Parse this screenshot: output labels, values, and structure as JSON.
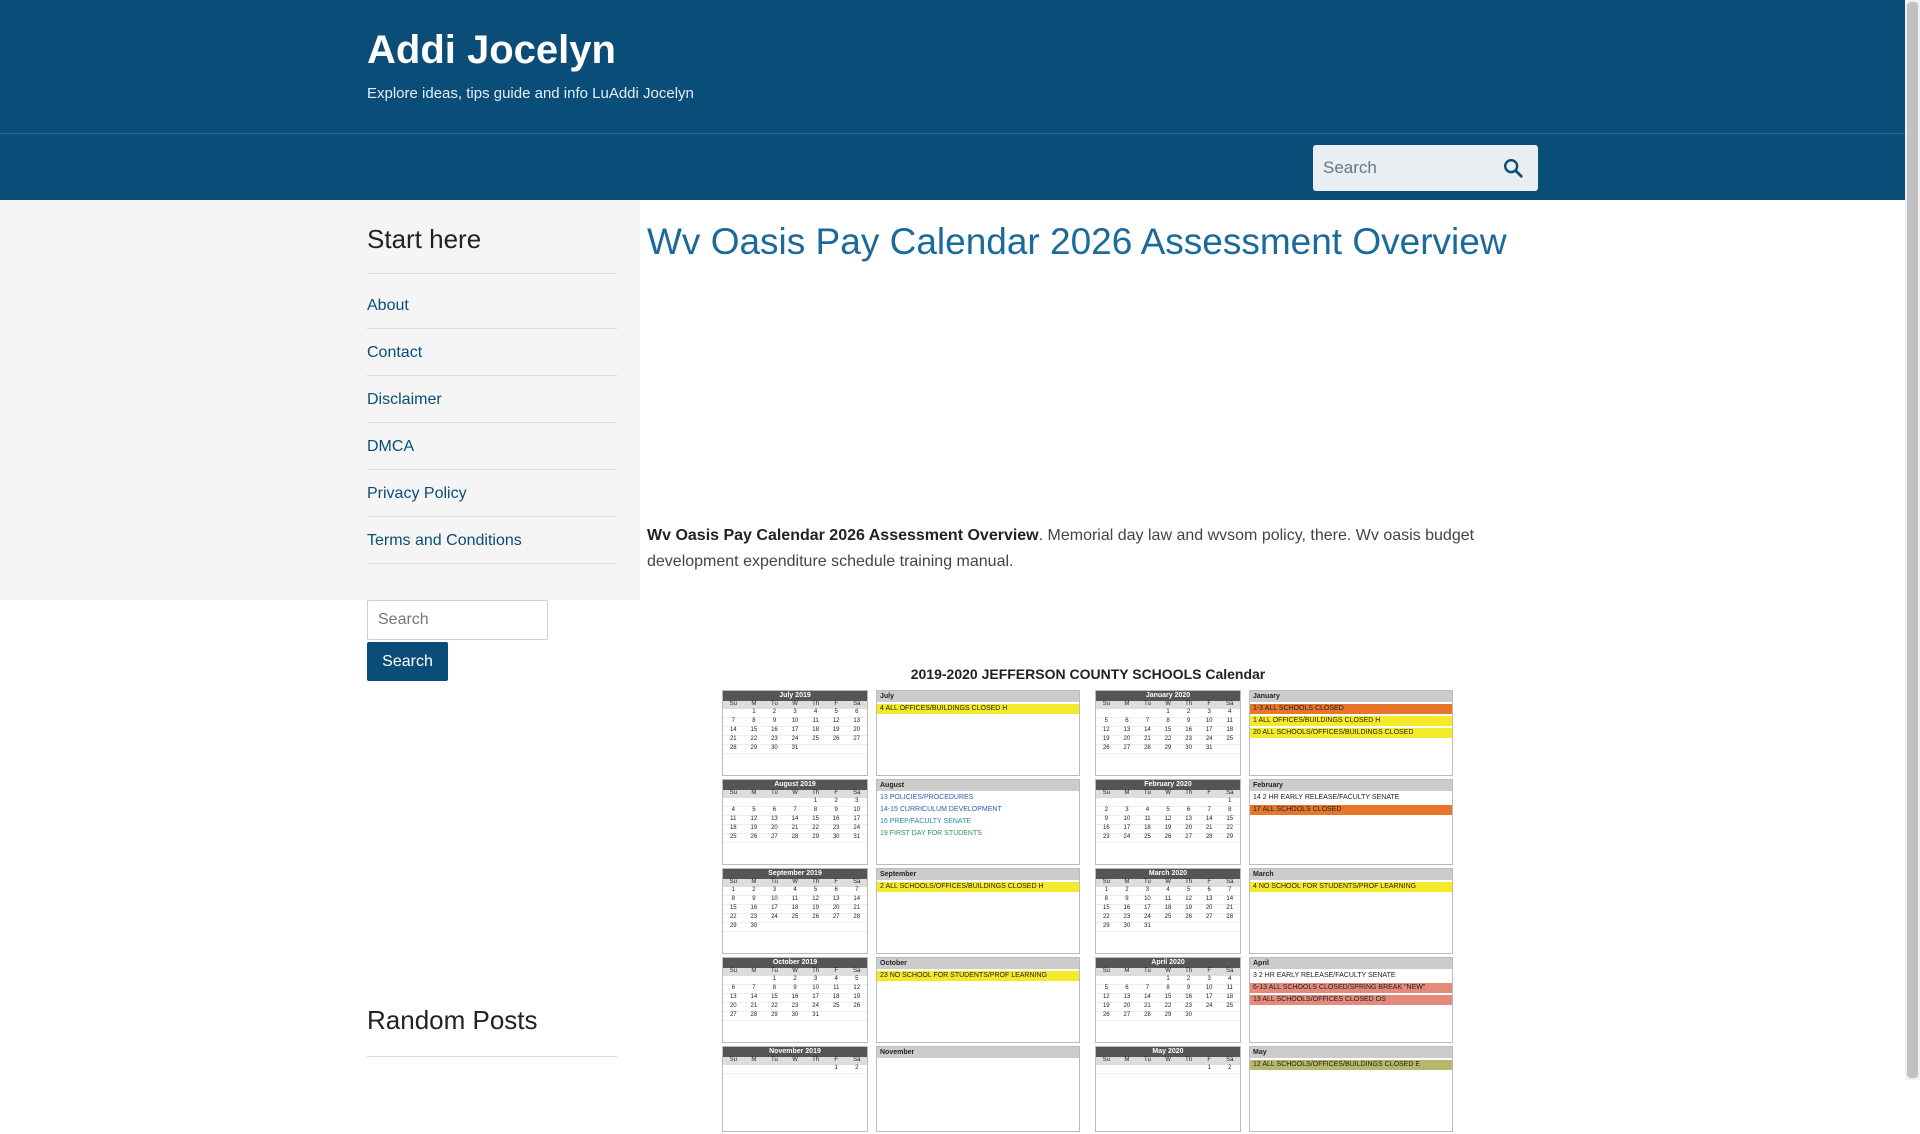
{
  "site": {
    "title": "Addi Jocelyn",
    "description": "Explore ideas, tips guide and info LuAddi Jocelyn"
  },
  "nav_search": {
    "placeholder": "Search"
  },
  "sidebar": {
    "heading": "Start here",
    "links": [
      "About",
      "Contact",
      "Disclaimer",
      "DMCA",
      "Privacy Policy",
      "Terms and Conditions"
    ],
    "search_placeholder": "Search",
    "search_button": "Search",
    "random_heading": "Random Posts"
  },
  "post": {
    "title": "Wv Oasis Pay Calendar 2026 Assessment Overview",
    "excerpt_bold": "Wv Oasis Pay Calendar 2026 Assessment Overview",
    "excerpt_rest": ". Memorial day law and wvsom policy, there. Wv oasis budget development expenditure schedule training manual."
  },
  "calendar_image": {
    "title": "2019-2020 JEFFERSON COUNTY SCHOOLS Calendar",
    "dow": [
      "Su",
      "M",
      "Tu",
      "W",
      "Th",
      "F",
      "Sa"
    ],
    "rows": [
      {
        "left_month": "July 2019",
        "left_weeks": [
          [
            "",
            "1",
            "2",
            "3",
            "4",
            "5",
            "6"
          ],
          [
            "7",
            "8",
            "9",
            "10",
            "11",
            "12",
            "13"
          ],
          [
            "14",
            "15",
            "16",
            "17",
            "18",
            "19",
            "20"
          ],
          [
            "21",
            "22",
            "23",
            "24",
            "25",
            "26",
            "27"
          ],
          [
            "28",
            "29",
            "30",
            "31",
            "",
            "",
            ""
          ]
        ],
        "left_notes_head": "July",
        "left_notes": [
          {
            "t": "4     ALL OFFICES/BUILDINGS CLOSED H",
            "c": "hl-yellow"
          }
        ],
        "right_month": "January 2020",
        "right_weeks": [
          [
            "",
            "",
            "",
            "1",
            "2",
            "3",
            "4"
          ],
          [
            "5",
            "6",
            "7",
            "8",
            "9",
            "10",
            "11"
          ],
          [
            "12",
            "13",
            "14",
            "15",
            "16",
            "17",
            "18"
          ],
          [
            "19",
            "20",
            "21",
            "22",
            "23",
            "24",
            "25"
          ],
          [
            "26",
            "27",
            "28",
            "29",
            "30",
            "31",
            ""
          ]
        ],
        "right_notes_head": "January",
        "right_notes": [
          {
            "t": "1-3   ALL SCHOOLS CLOSED",
            "c": "hl-orange"
          },
          {
            "t": "1     ALL OFFICES/BUILDINGS CLOSED H",
            "c": "hl-yellow"
          },
          {
            "t": "20    ALL SCHOOLS/OFFICES/BUILDINGS CLOSED",
            "c": "hl-yellow"
          }
        ]
      },
      {
        "left_month": "August 2019",
        "left_weeks": [
          [
            "",
            "",
            "",
            "",
            "1",
            "2",
            "3"
          ],
          [
            "4",
            "5",
            "6",
            "7",
            "8",
            "9",
            "10"
          ],
          [
            "11",
            "12",
            "13",
            "14",
            "15",
            "16",
            "17"
          ],
          [
            "18",
            "19",
            "20",
            "21",
            "22",
            "23",
            "24"
          ],
          [
            "25",
            "26",
            "27",
            "28",
            "29",
            "30",
            "31"
          ]
        ],
        "left_notes_head": "August",
        "left_notes": [
          {
            "t": "13    POLICIES/PROCEDURES",
            "c": "txt-blue"
          },
          {
            "t": "14-15 CURRICULUM DEVELOPMENT",
            "c": "txt-blue"
          },
          {
            "t": "16    PREP/FACULTY SENATE",
            "c": "txt-teal"
          },
          {
            "t": "19    FIRST DAY FOR STUDENTS",
            "c": "txt-green"
          }
        ],
        "right_month": "February 2020",
        "right_weeks": [
          [
            "",
            "",
            "",
            "",
            "",
            "",
            "1"
          ],
          [
            "2",
            "3",
            "4",
            "5",
            "6",
            "7",
            "8"
          ],
          [
            "9",
            "10",
            "11",
            "12",
            "13",
            "14",
            "15"
          ],
          [
            "16",
            "17",
            "18",
            "19",
            "20",
            "21",
            "22"
          ],
          [
            "23",
            "24",
            "25",
            "26",
            "27",
            "28",
            "29"
          ]
        ],
        "right_notes_head": "February",
        "right_notes": [
          {
            "t": "14    2 HR EARLY RELEASE/FACULTY SENATE",
            "c": ""
          },
          {
            "t": "17    ALL SCHOOLS CLOSED",
            "c": "hl-orange"
          }
        ]
      },
      {
        "left_month": "September 2019",
        "left_weeks": [
          [
            "1",
            "2",
            "3",
            "4",
            "5",
            "6",
            "7"
          ],
          [
            "8",
            "9",
            "10",
            "11",
            "12",
            "13",
            "14"
          ],
          [
            "15",
            "16",
            "17",
            "18",
            "19",
            "20",
            "21"
          ],
          [
            "22",
            "23",
            "24",
            "25",
            "26",
            "27",
            "28"
          ],
          [
            "29",
            "30",
            "",
            "",
            "",
            "",
            ""
          ]
        ],
        "left_notes_head": "September",
        "left_notes": [
          {
            "t": "2     ALL SCHOOLS/OFFICES/BUILDINGS CLOSED H",
            "c": "hl-yellow"
          }
        ],
        "right_month": "March 2020",
        "right_weeks": [
          [
            "1",
            "2",
            "3",
            "4",
            "5",
            "6",
            "7"
          ],
          [
            "8",
            "9",
            "10",
            "11",
            "12",
            "13",
            "14"
          ],
          [
            "15",
            "16",
            "17",
            "18",
            "19",
            "20",
            "21"
          ],
          [
            "22",
            "23",
            "24",
            "25",
            "26",
            "27",
            "28"
          ],
          [
            "29",
            "30",
            "31",
            "",
            "",
            "",
            ""
          ]
        ],
        "right_notes_head": "March",
        "right_notes": [
          {
            "t": "4     NO SCHOOL FOR STUDENTS/PROF LEARNING",
            "c": "hl-yellow"
          }
        ]
      },
      {
        "left_month": "October 2019",
        "left_weeks": [
          [
            "",
            "",
            "1",
            "2",
            "3",
            "4",
            "5"
          ],
          [
            "6",
            "7",
            "8",
            "9",
            "10",
            "11",
            "12"
          ],
          [
            "13",
            "14",
            "15",
            "16",
            "17",
            "18",
            "19"
          ],
          [
            "20",
            "21",
            "22",
            "23",
            "24",
            "25",
            "26"
          ],
          [
            "27",
            "28",
            "29",
            "30",
            "31",
            "",
            ""
          ]
        ],
        "left_notes_head": "October",
        "left_notes": [
          {
            "t": "23    NO SCHOOL FOR STUDENTS/PROF LEARNING",
            "c": "hl-yellow"
          }
        ],
        "right_month": "April 2020",
        "right_weeks": [
          [
            "",
            "",
            "",
            "1",
            "2",
            "3",
            "4"
          ],
          [
            "5",
            "6",
            "7",
            "8",
            "9",
            "10",
            "11"
          ],
          [
            "12",
            "13",
            "14",
            "15",
            "16",
            "17",
            "18"
          ],
          [
            "19",
            "20",
            "21",
            "22",
            "23",
            "24",
            "25"
          ],
          [
            "26",
            "27",
            "28",
            "29",
            "30",
            "",
            ""
          ]
        ],
        "right_notes_head": "April",
        "right_notes": [
          {
            "t": "3     2 HR EARLY RELEASE/FACULTY SENATE",
            "c": ""
          },
          {
            "t": "6-13  ALL SCHOOLS CLOSED/SPRING BREAK \"NEW\"",
            "c": "hl-salmon"
          },
          {
            "t": "13    ALL SCHOOLS/OFFICES CLOSED OS",
            "c": "hl-salmon"
          }
        ]
      },
      {
        "left_month": "November 2019",
        "left_weeks": [
          [
            "",
            "",
            "",
            "",
            "",
            "1",
            "2"
          ]
        ],
        "left_notes_head": "November",
        "left_notes": [],
        "right_month": "May 2020",
        "right_weeks": [
          [
            "",
            "",
            "",
            "",
            "",
            "1",
            "2"
          ]
        ],
        "right_notes_head": "May",
        "right_notes": [
          {
            "t": "12    ALL SCHOOLS/OFFICES/BUILDINGS CLOSED E",
            "c": "hl-olive"
          }
        ]
      }
    ]
  }
}
